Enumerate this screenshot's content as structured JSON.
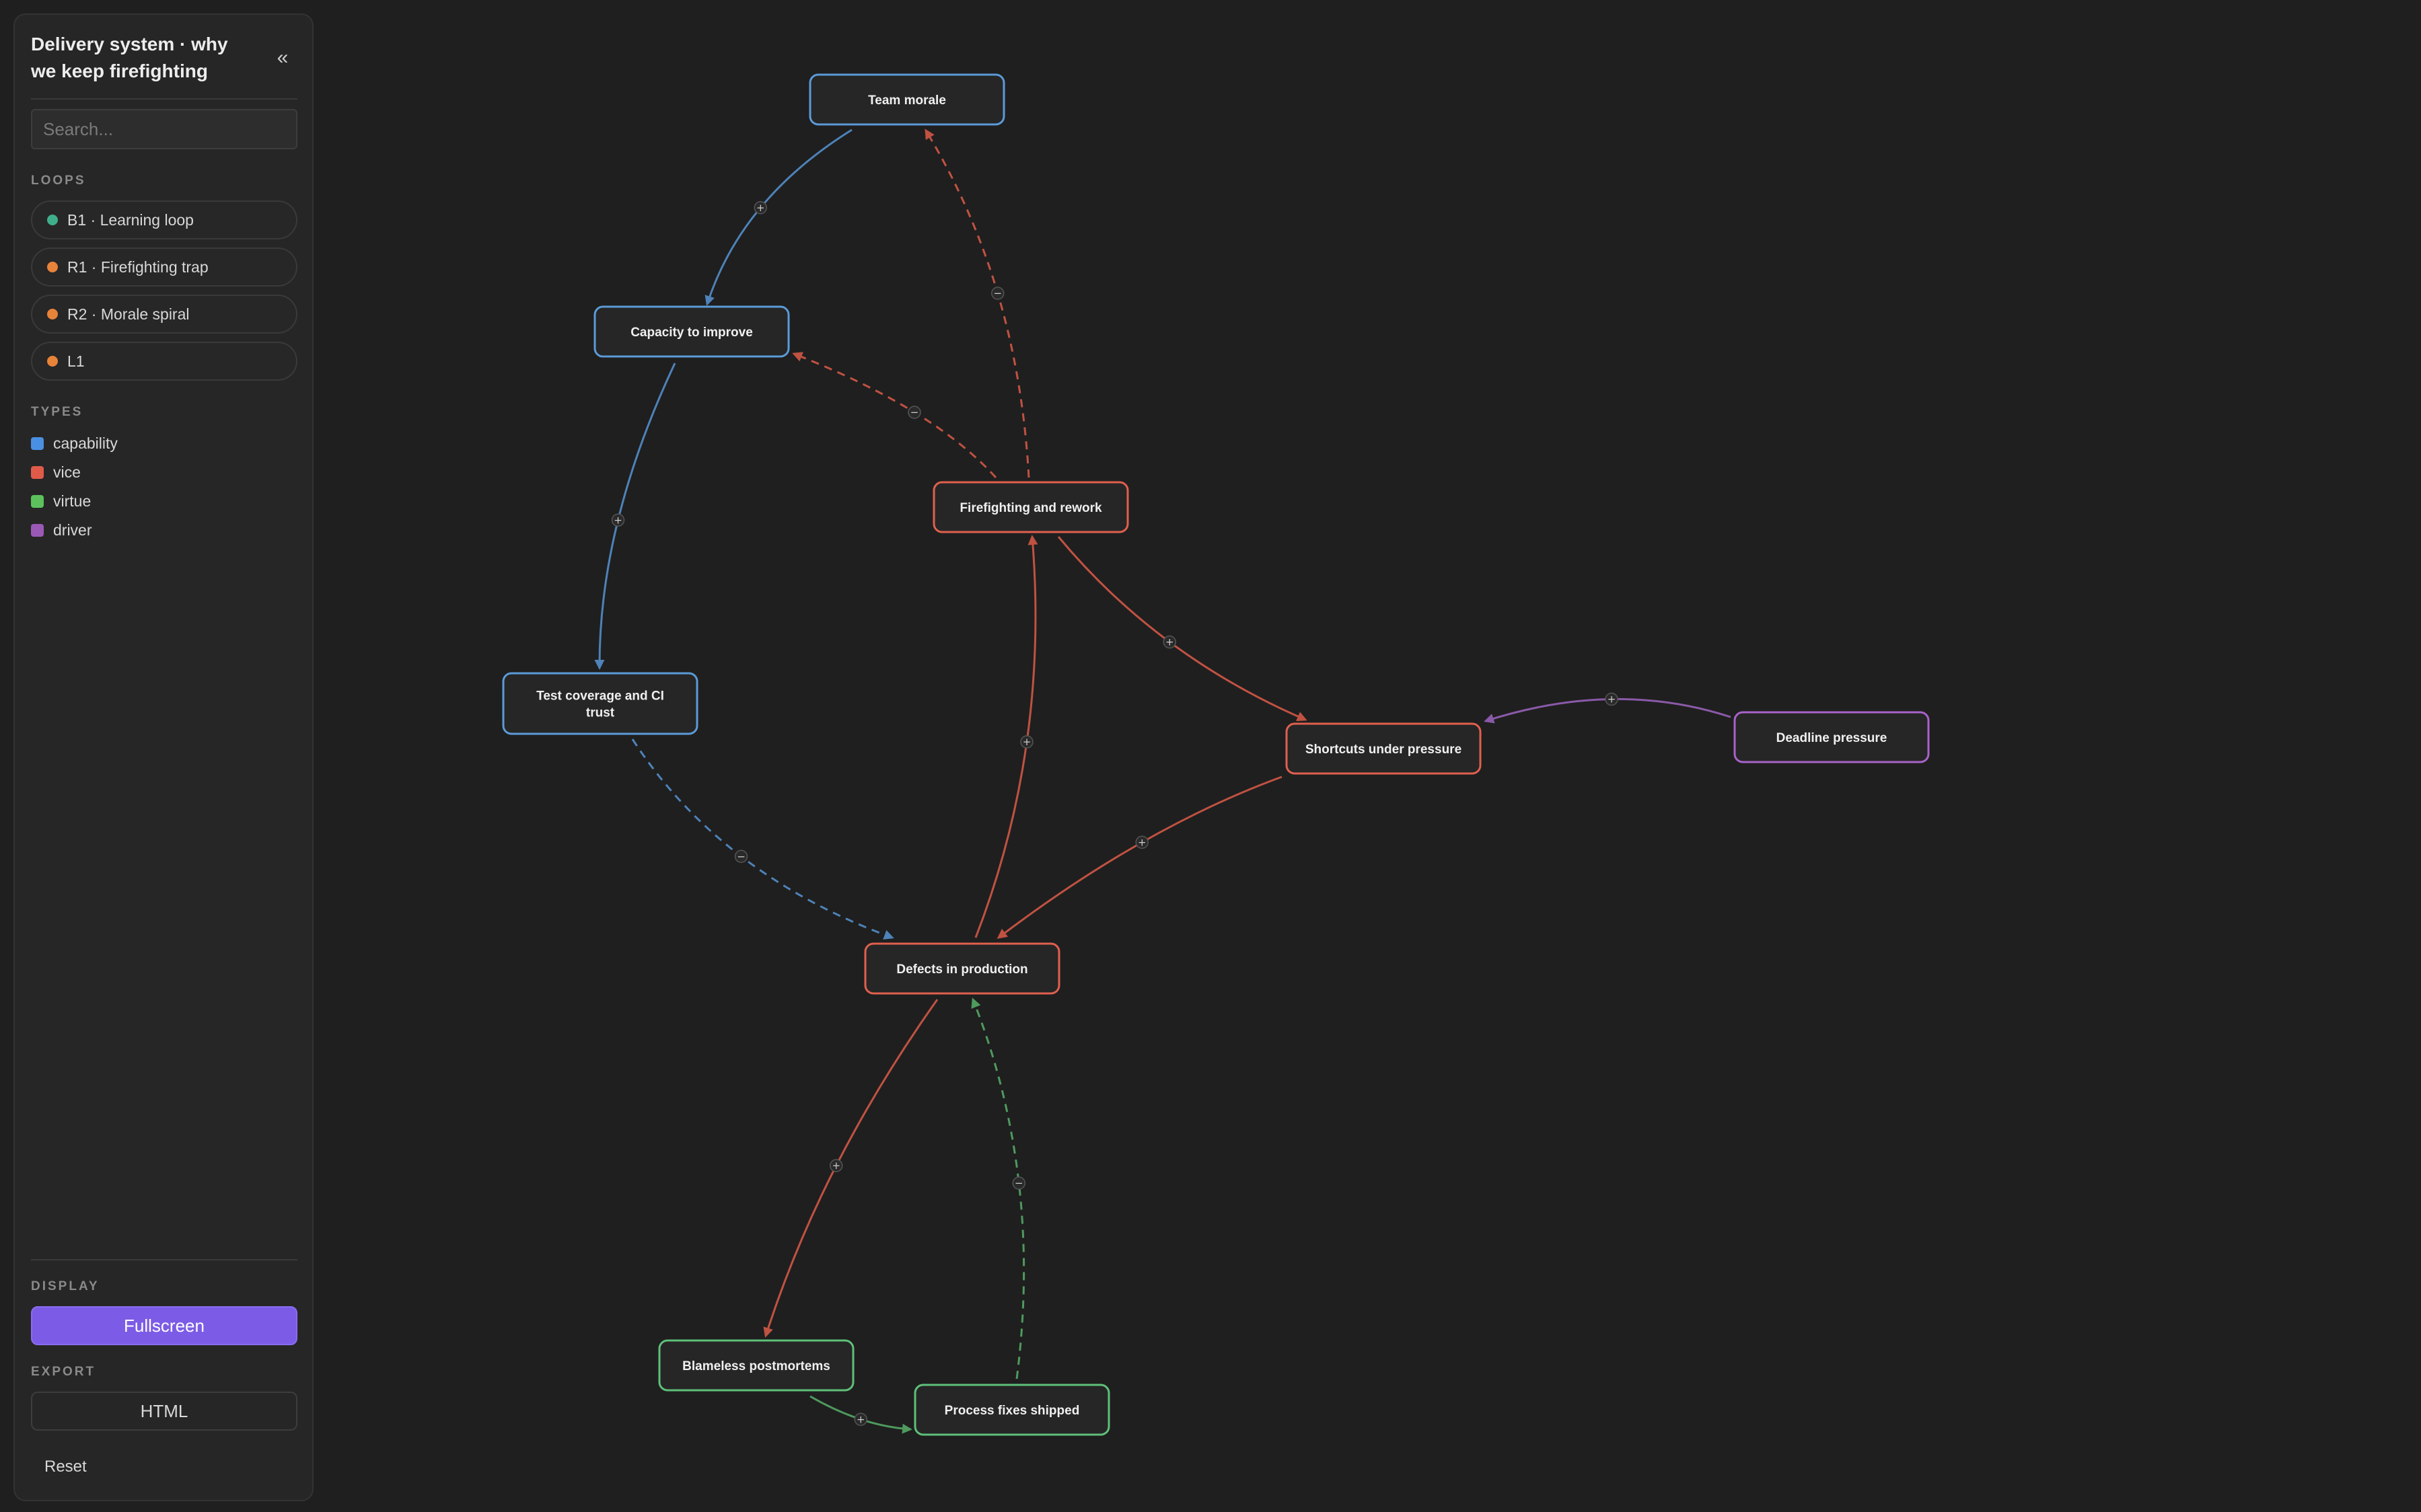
{
  "sidebar": {
    "title_line1": "Delivery system · why",
    "title_line2": "we keep firefighting",
    "collapse_icon": "«",
    "search_placeholder": "Search...",
    "loops_label": "LOOPS",
    "loops": [
      {
        "label": "B1 · Learning loop",
        "color": "#3fae8b"
      },
      {
        "label": "R1 · Firefighting trap",
        "color": "#e8833a"
      },
      {
        "label": "R2 · Morale spiral",
        "color": "#e8833a"
      },
      {
        "label": "L1",
        "color": "#e8833a"
      }
    ],
    "types_label": "TYPES",
    "types": [
      {
        "label": "capability",
        "color": "#4a90e2"
      },
      {
        "label": "vice",
        "color": "#e05a4a"
      },
      {
        "label": "virtue",
        "color": "#5cc15c"
      },
      {
        "label": "driver",
        "color": "#9b59b6"
      }
    ],
    "display_label": "DISPLAY",
    "fullscreen_label": "Fullscreen",
    "export_label": "EXPORT",
    "html_label": "HTML",
    "reset_label": "Reset"
  },
  "colors": {
    "capability": "#5b9bd8",
    "vice": "#e0604e",
    "virtue": "#5fc07a",
    "driver": "#a863c9",
    "edge_capability": "#4e82b8",
    "edge_vice": "#c05242",
    "edge_virtue": "#4f9a5e",
    "edge_driver": "#8a5aa8"
  },
  "nodes": [
    {
      "id": "morale",
      "lines": [
        "Team morale"
      ],
      "type": "capability"
    },
    {
      "id": "capacity",
      "lines": [
        "Capacity to improve"
      ],
      "type": "capability"
    },
    {
      "id": "firefighting",
      "lines": [
        "Firefighting and rework"
      ],
      "type": "vice"
    },
    {
      "id": "tests",
      "lines": [
        "Test coverage and CI",
        "trust"
      ],
      "type": "capability"
    },
    {
      "id": "shortcuts",
      "lines": [
        "Shortcuts under pressure"
      ],
      "type": "vice"
    },
    {
      "id": "deadline",
      "lines": [
        "Deadline pressure"
      ],
      "type": "driver"
    },
    {
      "id": "defects",
      "lines": [
        "Defects in production"
      ],
      "type": "vice"
    },
    {
      "id": "postmortems",
      "lines": [
        "Blameless postmortems"
      ],
      "type": "virtue"
    },
    {
      "id": "fixes",
      "lines": [
        "Process fixes shipped"
      ],
      "type": "virtue"
    }
  ],
  "edges": [
    {
      "from": "morale",
      "to": "capacity",
      "polarity": "+",
      "dashed": false,
      "type": "capability"
    },
    {
      "from": "firefighting",
      "to": "morale",
      "polarity": "−",
      "dashed": true,
      "type": "vice"
    },
    {
      "from": "firefighting",
      "to": "capacity",
      "polarity": "−",
      "dashed": true,
      "type": "vice"
    },
    {
      "from": "capacity",
      "to": "tests",
      "polarity": "+",
      "dashed": false,
      "type": "capability"
    },
    {
      "from": "firefighting",
      "to": "shortcuts",
      "polarity": "+",
      "dashed": false,
      "type": "vice"
    },
    {
      "from": "deadline",
      "to": "shortcuts",
      "polarity": "+",
      "dashed": false,
      "type": "driver"
    },
    {
      "from": "defects",
      "to": "firefighting",
      "polarity": "+",
      "dashed": false,
      "type": "vice"
    },
    {
      "from": "tests",
      "to": "defects",
      "polarity": "−",
      "dashed": true,
      "type": "capability"
    },
    {
      "from": "shortcuts",
      "to": "defects",
      "polarity": "+",
      "dashed": false,
      "type": "vice"
    },
    {
      "from": "defects",
      "to": "postmortems",
      "polarity": "+",
      "dashed": false,
      "type": "vice"
    },
    {
      "from": "fixes",
      "to": "defects",
      "polarity": "−",
      "dashed": true,
      "type": "virtue"
    },
    {
      "from": "postmortems",
      "to": "fixes",
      "polarity": "+",
      "dashed": false,
      "type": "virtue"
    }
  ]
}
